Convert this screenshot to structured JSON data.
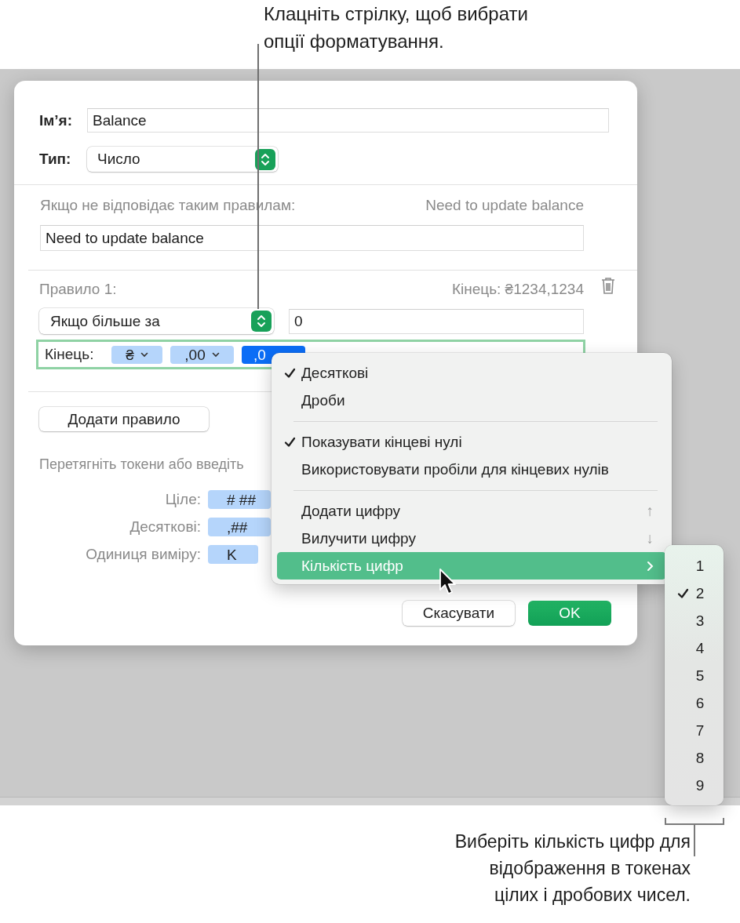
{
  "callout_top": {
    "lines": [
      "Клацніть стрілку, щоб вибрати",
      "опції форматування."
    ]
  },
  "dialog": {
    "name_label": "Ім’я:",
    "name_value": "Balance",
    "type_label": "Тип:",
    "type_value": "Число",
    "fallback": {
      "label": "Якщо не відповідає таким правилам:",
      "preview": "Need to update balance",
      "value": "Need to update balance"
    },
    "rule": {
      "label": "Правило 1:",
      "preview": "Кінець: ₴1234,1234",
      "condition": "Якщо більше за",
      "operand": "0",
      "format_label": "Кінець:",
      "tokens": [
        {
          "text": "₴",
          "dropdown": true,
          "selected": false
        },
        {
          "text": ",00",
          "dropdown": true,
          "selected": false
        },
        {
          "text": ",0",
          "dropdown": false,
          "selected": true
        }
      ]
    },
    "add_rule_button": "Додати правило",
    "hint": "Перетягніть токени або введіть",
    "token_rows": [
      {
        "label": "Ціле:",
        "token": "# ##"
      },
      {
        "label": "Десяткові:",
        "token": ",##"
      },
      {
        "label": "Одиниця виміру:",
        "token": "K"
      }
    ],
    "buttons": [
      {
        "label": "Скасувати",
        "kind": "secondary"
      },
      {
        "label": "OK",
        "kind": "primary"
      }
    ]
  },
  "format_menu": {
    "items": [
      {
        "kind": "item",
        "label": "Десяткові",
        "checked": true,
        "selected": false
      },
      {
        "kind": "item",
        "label": "Дроби",
        "checked": false,
        "selected": false
      },
      {
        "kind": "separator"
      },
      {
        "kind": "item",
        "label": "Показувати кінцеві нулі",
        "checked": true,
        "selected": false
      },
      {
        "kind": "item",
        "label": "Використовувати пробіли для кінцевих нулів",
        "checked": false,
        "selected": false
      },
      {
        "kind": "separator"
      },
      {
        "kind": "item",
        "label": "Додати цифру",
        "shortcut": "↑",
        "checked": false,
        "selected": false
      },
      {
        "kind": "item",
        "label": "Вилучити цифру",
        "shortcut": "↓",
        "checked": false,
        "selected": false
      },
      {
        "kind": "submenu",
        "label": "Кількість цифр",
        "checked": false,
        "selected": true
      }
    ]
  },
  "digits_submenu": {
    "items": [
      {
        "label": "1",
        "checked": false
      },
      {
        "label": "2",
        "checked": true
      },
      {
        "label": "3",
        "checked": false
      },
      {
        "label": "4",
        "checked": false
      },
      {
        "label": "5",
        "checked": false
      },
      {
        "label": "6",
        "checked": false
      },
      {
        "label": "7",
        "checked": false
      },
      {
        "label": "8",
        "checked": false
      },
      {
        "label": "9",
        "checked": false
      }
    ]
  },
  "callout_bottom": {
    "lines": [
      "Виберіть кількість цифр для",
      "відображення в токенах",
      "цілих і дробових чисел."
    ]
  }
}
